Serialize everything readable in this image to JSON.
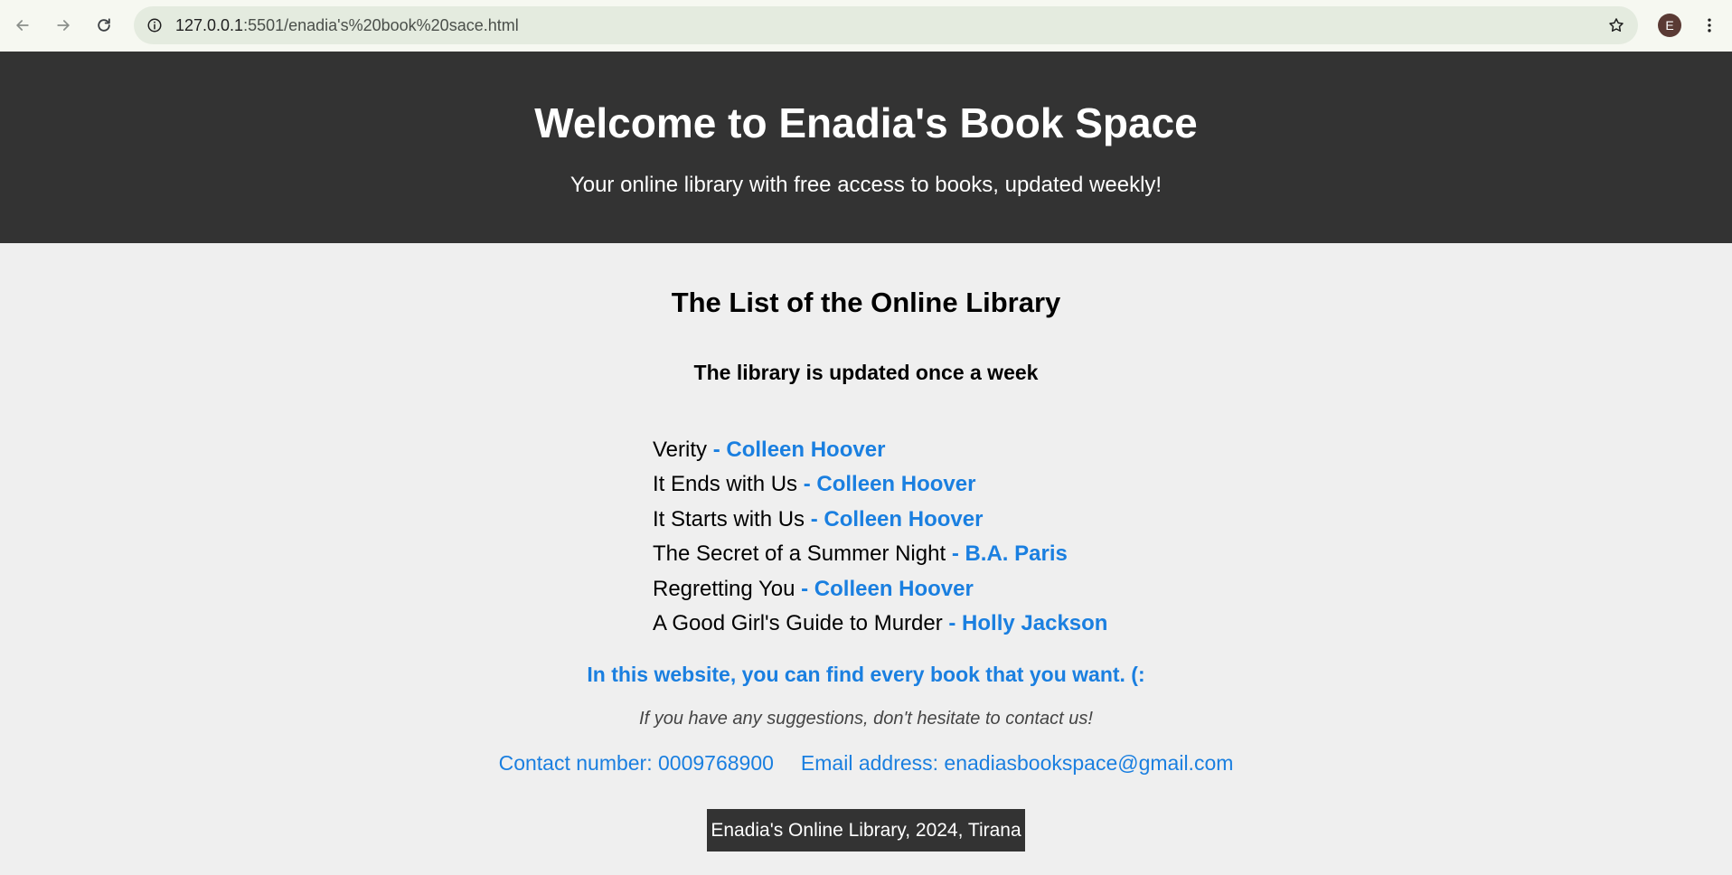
{
  "browser": {
    "url_host": "127.0.0.1",
    "url_path": ":5501/enadia's%20book%20sace.html",
    "profile_initial": "E",
    "icons": {
      "back": "arrow-left-icon",
      "forward": "arrow-right-icon",
      "reload": "reload-icon",
      "site_info": "info-icon",
      "bookmark": "star-icon",
      "menu": "kebab-menu-icon"
    }
  },
  "header": {
    "title": "Welcome to Enadia's Book Space",
    "subtitle": "Your online library with free access to books, updated weekly!"
  },
  "main": {
    "list_heading": "The List of the Online Library",
    "update_note": "The library is updated once a week",
    "books": [
      {
        "title": "Verity",
        "author": "- Colleen Hoover"
      },
      {
        "title": "It Ends with Us",
        "author": "- Colleen Hoover"
      },
      {
        "title": "It Starts with Us",
        "author": "- Colleen Hoover"
      },
      {
        "title": "The Secret of a Summer Night",
        "author": "- B.A. Paris"
      },
      {
        "title": "Regretting You",
        "author": "- Colleen Hoover"
      },
      {
        "title": "A Good Girl's Guide to Murder",
        "author": "- Holly Jackson"
      }
    ],
    "tagline": "In this website, you can find every book that you want. (:",
    "suggestion": "If you have any suggestions, don't hesitate to contact us!",
    "contact_number": "Contact number: 0009768900",
    "email_address": "Email address: enadiasbookspace@gmail.com"
  },
  "footer": {
    "text": "Enadia's Online Library, 2024, Tirana"
  },
  "colors": {
    "header_bg": "#333333",
    "page_bg": "#efefef",
    "accent_blue": "#1a7fe0",
    "footer_bg": "#333333"
  }
}
